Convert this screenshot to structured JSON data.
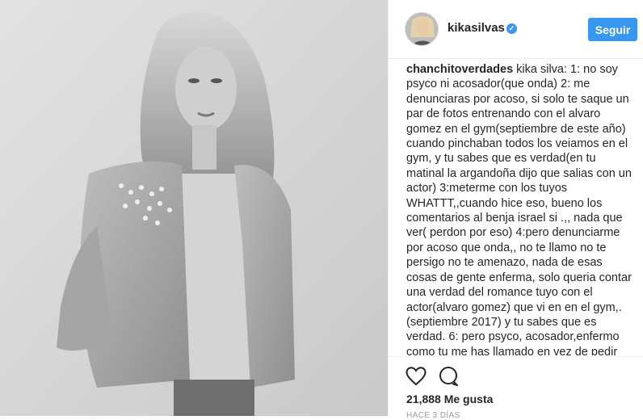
{
  "post": {
    "username": "kikasilvas",
    "follow_label": "Seguir",
    "comment_author": "chanchitoverdades",
    "comment_text": "kika silva: 1: no soy psyco ni acosador(que onda) 2: me denunciaras por acoso, si solo te saque un par de fotos entrenando con el alvaro gomez en el gym(septiembre de este año) cuando pinchaban todos los veiamos en el gym, y tu sabes que es verdad(en tu matinal la argandoña dijo que salias con un actor) 3:meterme con los tuyos WHATTT,,cuando hice eso, bueno los comentarios al benja israel si .,, nada que ver( perdon por eso) 4:pero denunciarme por acoso que onda,, no te llamo no te persigo no te amenazo, nada de esas cosas de gente enferma, solo queria contar una verdad del romance tuyo con el actor(alvaro gomez) que vi en en el gym,.(septiembre 2017) y tu sabes que es verdad. 6: pero psyco, acosador,enfermo como tu me has llamado en vez de pedir disculpas",
    "likes": "21,888 Me gusta",
    "timestamp": "HACE 3 DÍAS"
  },
  "icons": {
    "like": "heart-icon",
    "comment": "comment-bubble-icon",
    "verified": "verified-badge-icon"
  },
  "colors": {
    "accent": "#3897f0",
    "text": "#262626",
    "muted": "#999999",
    "border": "#efefef"
  }
}
